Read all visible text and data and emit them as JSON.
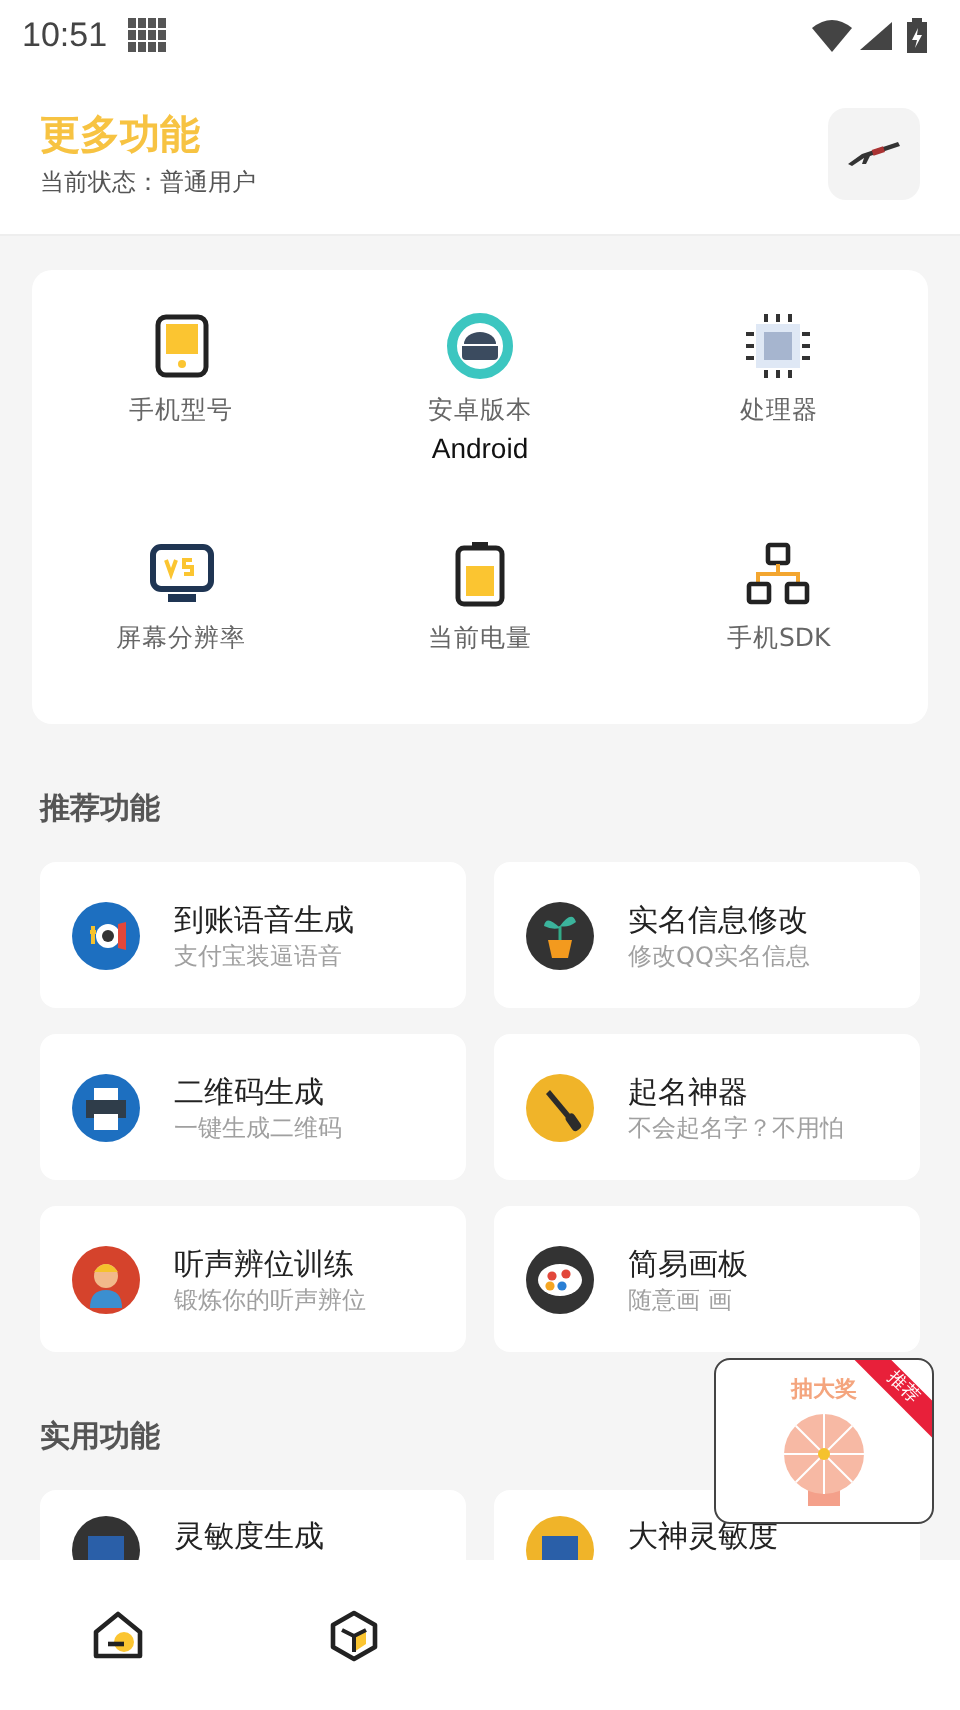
{
  "status_bar": {
    "time": "10:51"
  },
  "header": {
    "title": "更多功能",
    "status": "当前状态：普通用户"
  },
  "device_info": [
    {
      "label": "手机型号"
    },
    {
      "label": "安卓版本",
      "value": "Android"
    },
    {
      "label": "处理器"
    },
    {
      "label": "屏幕分辨率"
    },
    {
      "label": "当前电量"
    },
    {
      "label": "手机SDK"
    }
  ],
  "sections": [
    {
      "title": "推荐功能",
      "items": [
        {
          "title": "到账语音生成",
          "subtitle": "支付宝装逼语音"
        },
        {
          "title": "实名信息修改",
          "subtitle": "修改QQ实名信息"
        },
        {
          "title": "二维码生成",
          "subtitle": "一键生成二维码"
        },
        {
          "title": "起名神器",
          "subtitle": "不会起名字？不用怕"
        },
        {
          "title": "听声辨位训练",
          "subtitle": "锻炼你的听声辨位"
        },
        {
          "title": "简易画板",
          "subtitle": "随意画 画"
        }
      ]
    },
    {
      "title": "实用功能",
      "items": [
        {
          "title": "灵敏度生成"
        },
        {
          "title": "大神灵敏度"
        }
      ]
    }
  ],
  "popup": {
    "label": "抽大奖",
    "badge": "推荐"
  }
}
